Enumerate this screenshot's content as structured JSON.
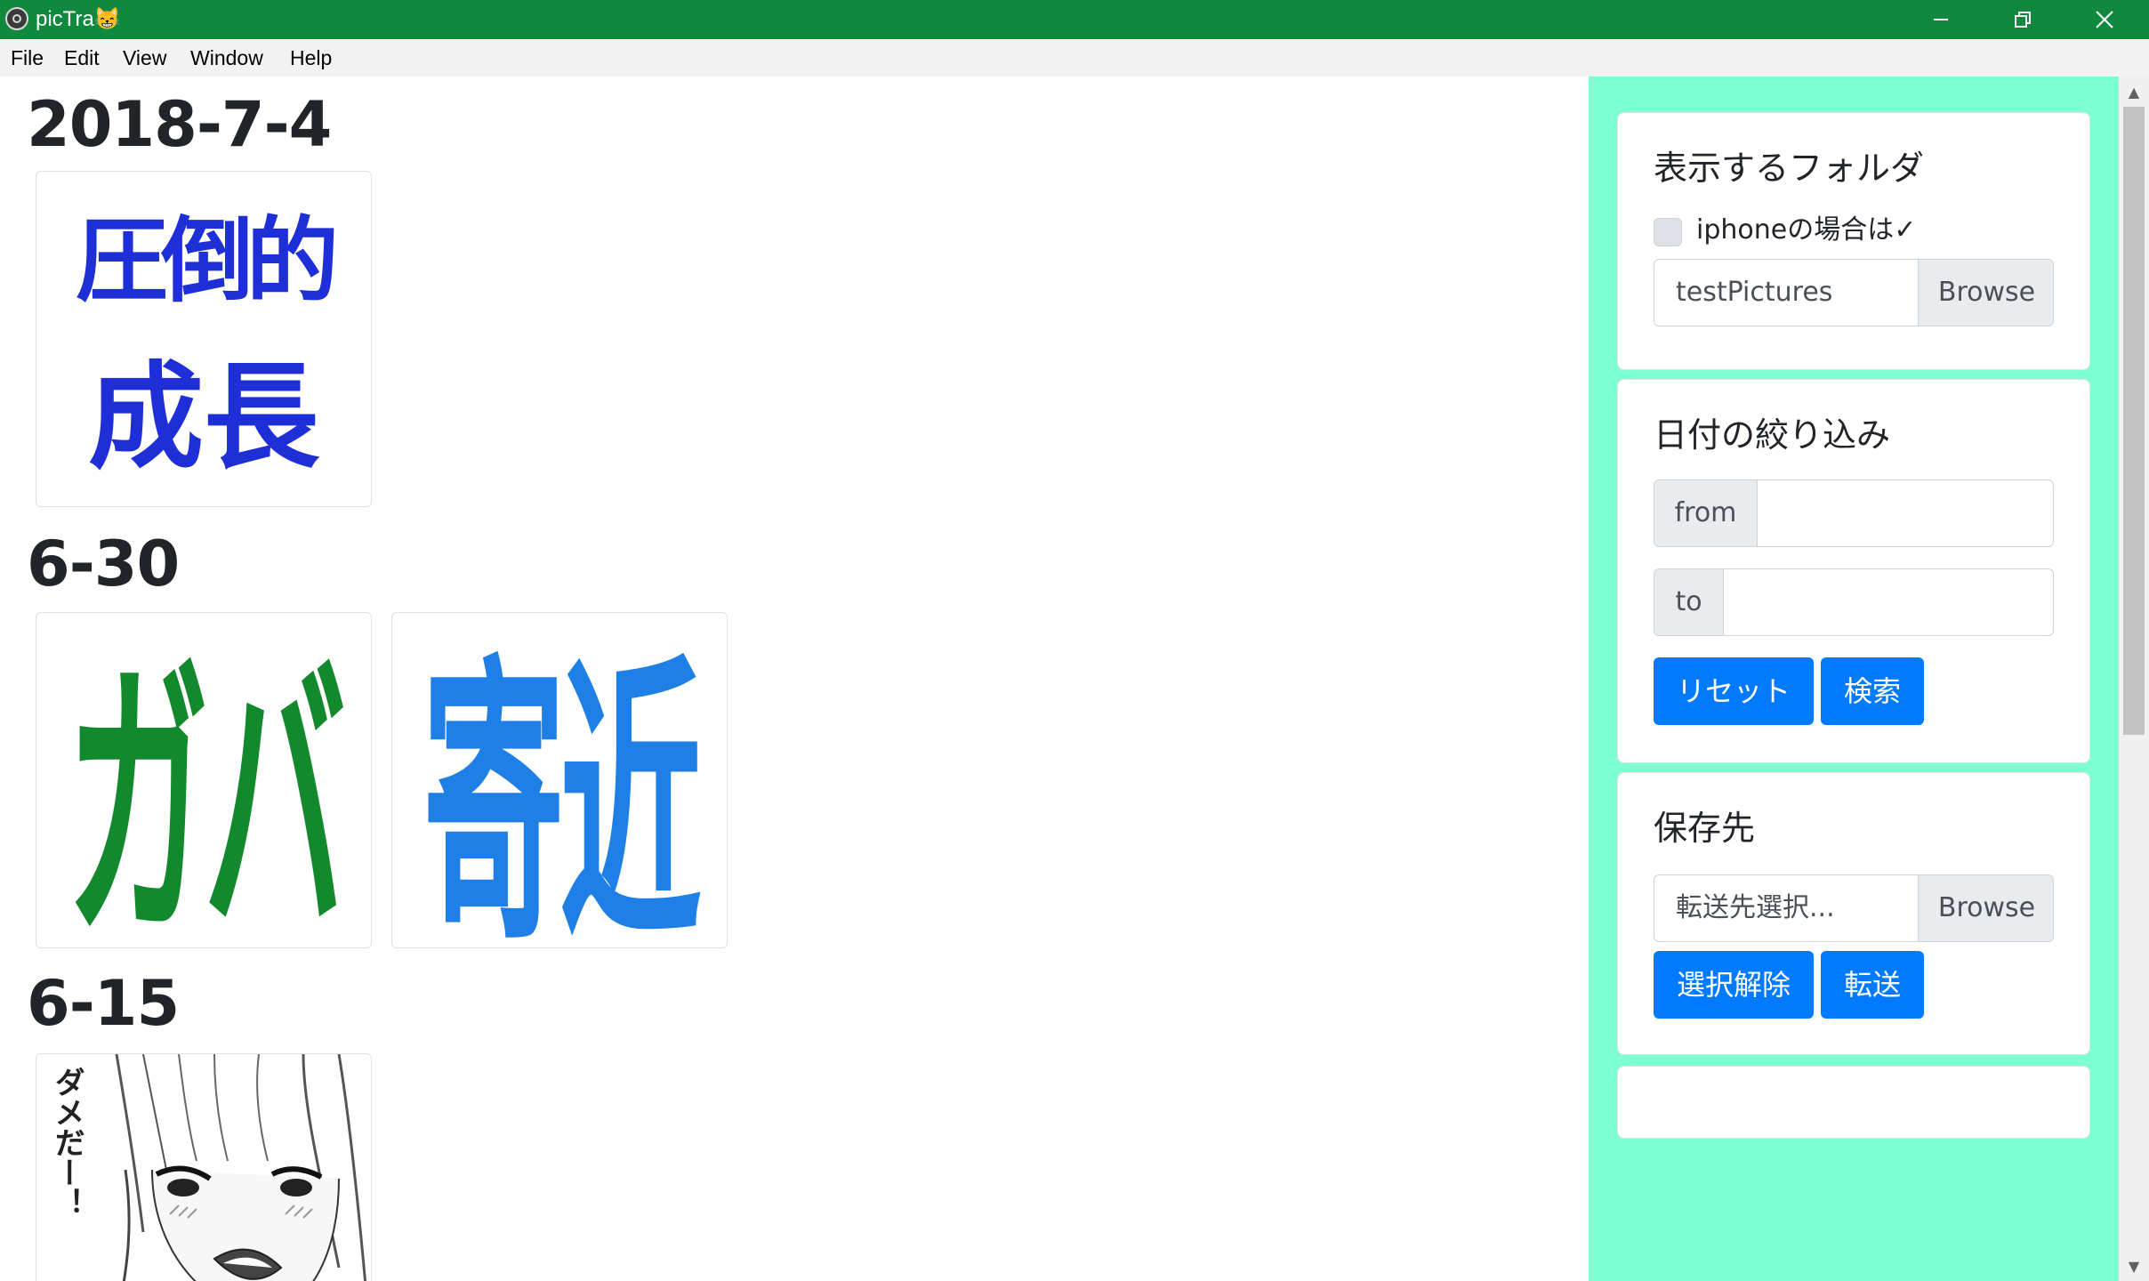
{
  "window": {
    "title": "picTra😸",
    "app_icon": "electron-icon",
    "title_bar_color": "#10893e",
    "controls": [
      "minimize-icon",
      "restore-icon",
      "close-icon"
    ]
  },
  "menu": [
    "File",
    "Edit",
    "View",
    "Window",
    "Help"
  ],
  "gallery": {
    "groups": [
      {
        "date": "2018-7-4",
        "images": [
          {
            "lines": [
              "圧倒的",
              "成長"
            ],
            "color": "#1f2fd8"
          }
        ]
      },
      {
        "date": "6-30",
        "images": [
          {
            "lines": [
              "ガバ"
            ],
            "color": "#13892d"
          },
          {
            "lines": [
              "寄近"
            ],
            "color": "#1e7fe6"
          }
        ]
      },
      {
        "date": "6-15",
        "images": [
          {
            "lines": [
              "ダメだー！"
            ],
            "kind": "manga-illustration"
          }
        ]
      }
    ]
  },
  "sidebar": {
    "background": "#7fffd4",
    "folder_card": {
      "title": "表示するフォルダ",
      "iphone_checkbox_label": "iphoneの場合は✓",
      "iphone_checked": false,
      "folder_value": "testPictures",
      "browse_label": "Browse"
    },
    "date_card": {
      "title": "日付の絞り込み",
      "from_label": "from",
      "from_value": "",
      "to_label": "to",
      "to_value": "",
      "reset_label": "リセット",
      "search_label": "検索"
    },
    "dest_card": {
      "title": "保存先",
      "dest_placeholder": "転送先選択...",
      "browse_label": "Browse",
      "clear_label": "選択解除",
      "transfer_label": "転送"
    }
  },
  "colors": {
    "primary_button": "#007bff",
    "addon_gray": "#e9ecef"
  }
}
